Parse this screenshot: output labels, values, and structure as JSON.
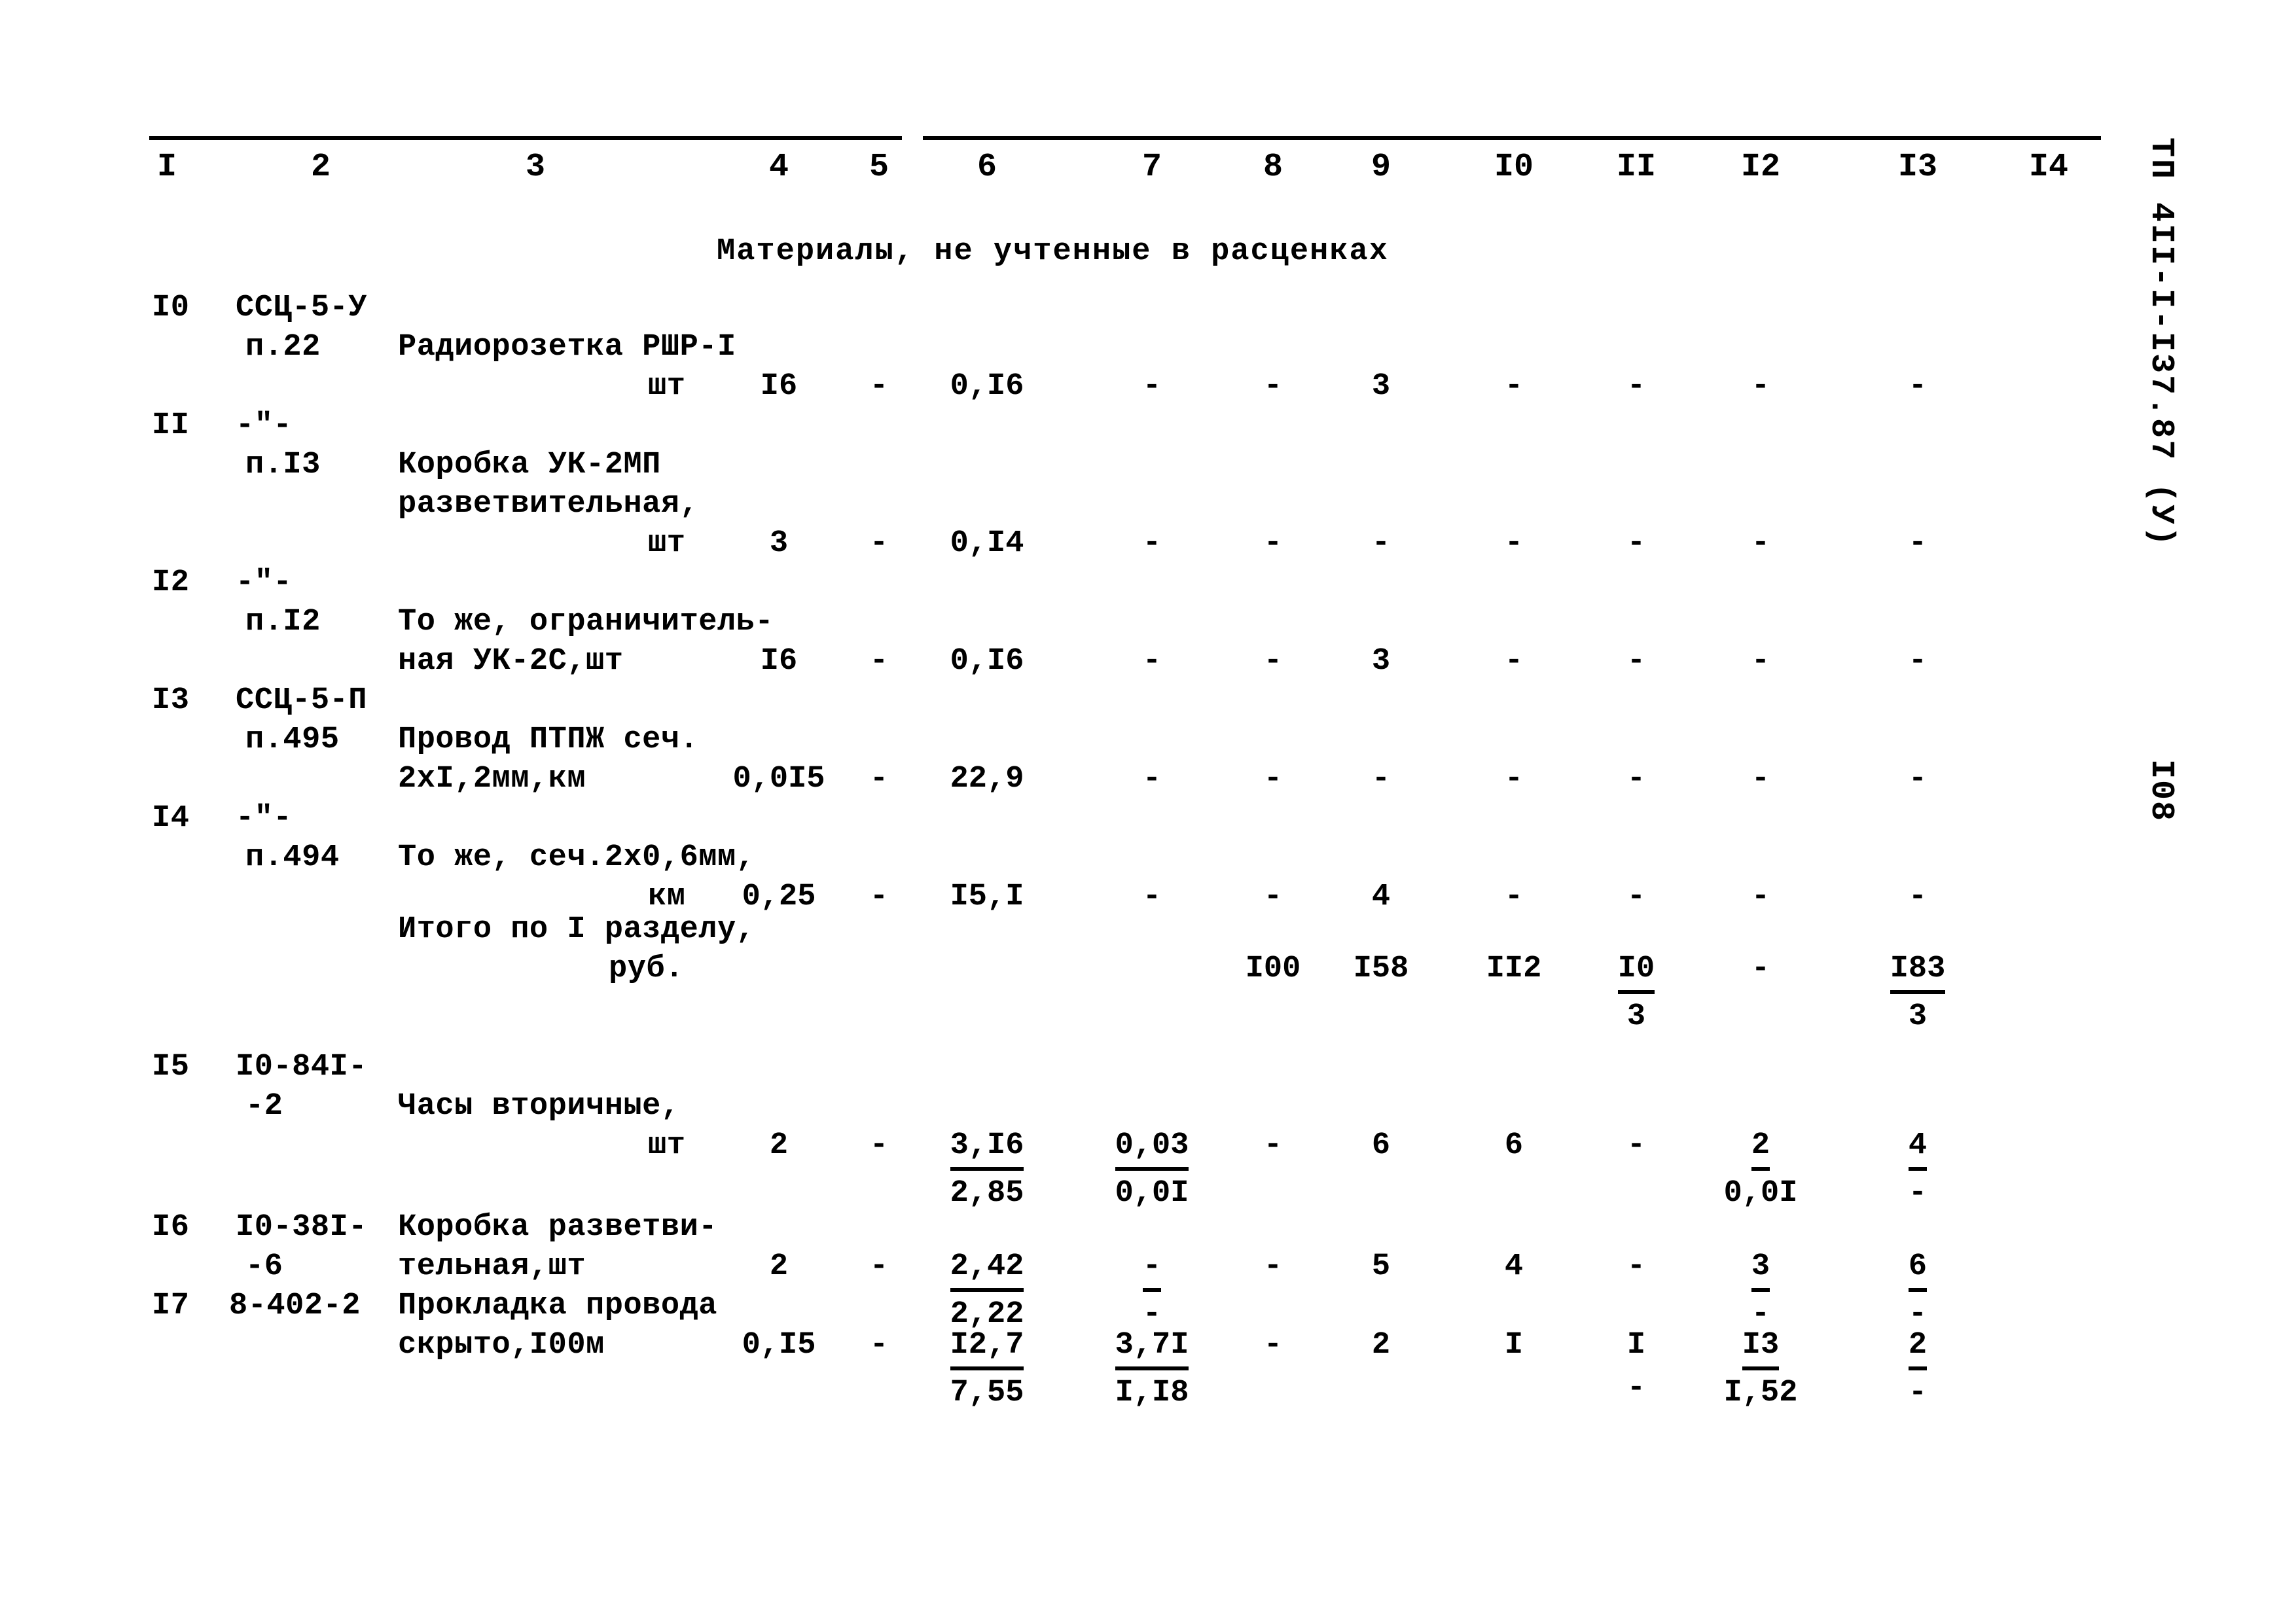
{
  "document": {
    "margin_code": "ТП 4II-I-I37.87 (У)",
    "page_number": "I08"
  },
  "table": {
    "column_headers": [
      "I",
      "2",
      "3",
      "4",
      "5",
      "6",
      "7",
      "8",
      "9",
      "I0",
      "II",
      "I2",
      "I3",
      "I4"
    ],
    "section_caption": "Материалы, не учтенные в расценках",
    "rows": [
      {
        "no": "I0",
        "code_line1": "ССЦ-5-У",
        "code_line2": "п.22",
        "name_line1": "Радиорозетка РШР-I",
        "name_line2": "",
        "unit": "шт",
        "c4": "I6",
        "c5": "-",
        "c6_top": "0,I6",
        "c6_bot": "",
        "c7_top": "-",
        "c7_bot": "",
        "c8": "-",
        "c9": "3",
        "c10": "-",
        "c11": "-",
        "c12_top": "-",
        "c12_bot": "",
        "c13_top": "-",
        "c13_bot": "",
        "c14": ""
      },
      {
        "no": "II",
        "code_line1": "-\"-",
        "code_line2": "п.I3",
        "name_line1": "Коробка УК-2МП",
        "name_line2": "разветвительная,",
        "unit": "шт",
        "c4": "3",
        "c5": "-",
        "c6_top": "0,I4",
        "c6_bot": "",
        "c7_top": "-",
        "c7_bot": "",
        "c8": "-",
        "c9": "-",
        "c10": "-",
        "c11": "-",
        "c12_top": "-",
        "c12_bot": "",
        "c13_top": "-",
        "c13_bot": "",
        "c14": ""
      },
      {
        "no": "I2",
        "code_line1": "-\"-",
        "code_line2": "п.I2",
        "name_line1": "То же, ограничитель-",
        "name_line2": "ная УК-2С,шт",
        "unit": "",
        "c4": "I6",
        "c5": "-",
        "c6_top": "0,I6",
        "c6_bot": "",
        "c7_top": "-",
        "c7_bot": "",
        "c8": "-",
        "c9": "3",
        "c10": "-",
        "c11": "-",
        "c12_top": "-",
        "c12_bot": "",
        "c13_top": "-",
        "c13_bot": "",
        "c14": ""
      },
      {
        "no": "I3",
        "code_line1": "ССЦ-5-П",
        "code_line2": "п.495",
        "name_line1": "Провод ПТПЖ сеч.",
        "name_line2": "2хI,2мм,км",
        "unit": "",
        "c4": "0,0I5",
        "c5": "-",
        "c6_top": "22,9",
        "c6_bot": "",
        "c7_top": "-",
        "c7_bot": "",
        "c8": "-",
        "c9": "-",
        "c10": "-",
        "c11": "-",
        "c12_top": "-",
        "c12_bot": "",
        "c13_top": "-",
        "c13_bot": "",
        "c14": ""
      },
      {
        "no": "I4",
        "code_line1": "-\"-",
        "code_line2": "п.494",
        "name_line1": "То же, сеч.2х0,6мм,",
        "name_line2": "км",
        "unit": "",
        "c4": "0,25",
        "c5": "-",
        "c6_top": "I5,I",
        "c6_bot": "",
        "c7_top": "-",
        "c7_bot": "",
        "c8": "-",
        "c9": "4",
        "c10": "-",
        "c11": "-",
        "c12_top": "-",
        "c12_bot": "",
        "c13_top": "-",
        "c13_bot": "",
        "c14": ""
      }
    ],
    "subtotal": {
      "label_line1": "Итого по I разделу,",
      "label_line2": "руб.",
      "c8": "I00",
      "c9": "I58",
      "c10": "II2",
      "c11_top": "I0",
      "c11_bot": "3",
      "c12": "-",
      "c13_top": "I83",
      "c13_bot": "3"
    },
    "rows2": [
      {
        "no": "I5",
        "code_line1": "I0-84I-",
        "code_line2": "-2",
        "name_line1": "Часы вторичные,",
        "name_line2": "",
        "unit": "шт",
        "c4": "2",
        "c5": "-",
        "c6_top": "3,I6",
        "c6_bot": "2,85",
        "c7_top": "0,03",
        "c7_bot": "0,0I",
        "c8": "-",
        "c9": "6",
        "c10": "6",
        "c11": "-",
        "c12_top": "2",
        "c12_bot": "0,0I",
        "c13_top": "4",
        "c13_bot": "-",
        "c14": ""
      },
      {
        "no": "I6",
        "code_line1": "I0-38I-",
        "code_line2": "-6",
        "name_line1": "Коробка разветви-",
        "name_line2": "тельная,шт",
        "unit": "",
        "c4": "2",
        "c5": "-",
        "c6_top": "2,42",
        "c6_bot": "2,22",
        "c7_top": "-",
        "c7_bot": "-",
        "c8": "-",
        "c9": "5",
        "c10": "4",
        "c11": "-",
        "c12_top": "3",
        "c12_bot": "-",
        "c13_top": "6",
        "c13_bot": "-",
        "c14": ""
      },
      {
        "no": "I7",
        "code_line1": "8-402-2",
        "code_line2": "",
        "name_line1": "Прокладка провода",
        "name_line2": "скрыто,I00м",
        "unit": "",
        "c4": "0,I5",
        "c5": "-",
        "c6_top": "I2,7",
        "c6_bot": "7,55",
        "c7_top": "3,7I",
        "c7_bot": "I,I8",
        "c8": "-",
        "c9": "2",
        "c10": "I",
        "c11": "I",
        "c11_bot": "-",
        "c12_top": "I3",
        "c12_bot": "I,52",
        "c13_top": "2",
        "c13_bot": "-",
        "c14": ""
      }
    ]
  }
}
